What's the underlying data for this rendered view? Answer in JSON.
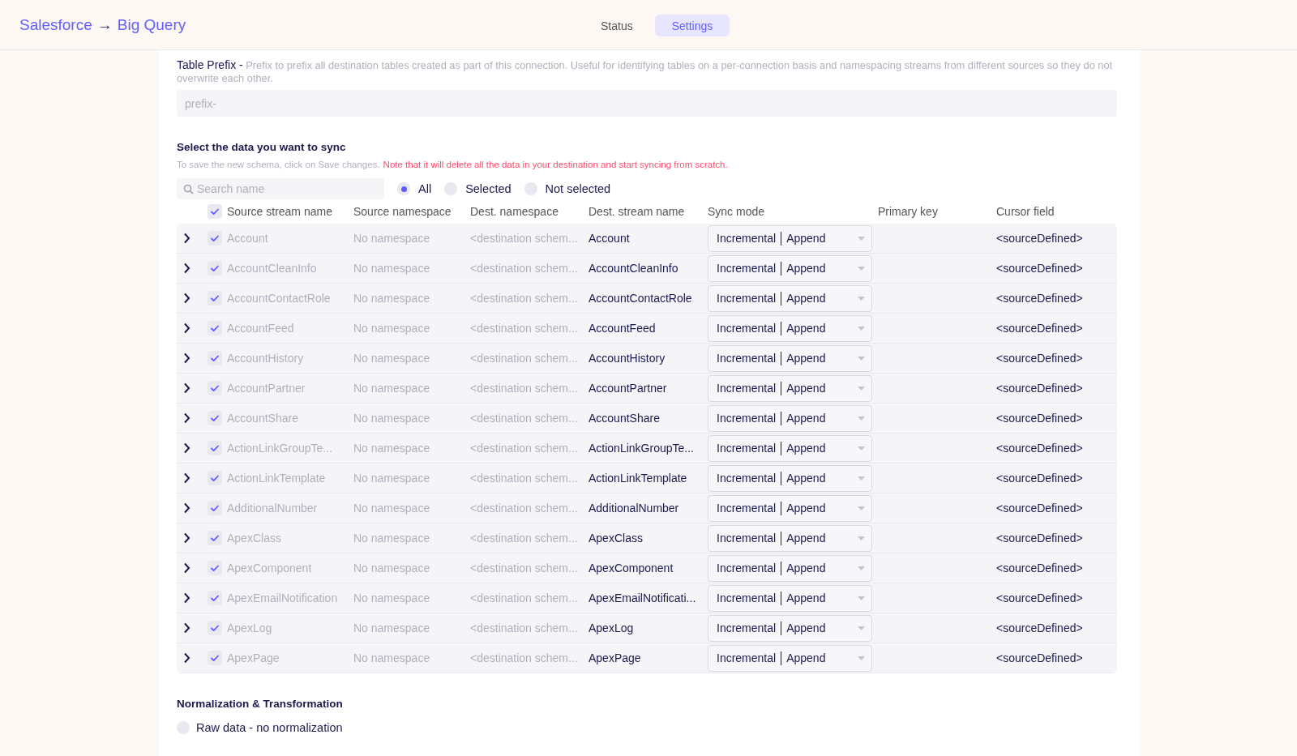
{
  "header": {
    "source": "Salesforce",
    "arrow": "→",
    "destination": "Big Query"
  },
  "tabs": [
    {
      "label": "Status",
      "selected": false
    },
    {
      "label": "Settings",
      "selected": true
    }
  ],
  "table_prefix": {
    "text": "**Table Prefix -** Prefix to prefix all destination tables created as part of this connection. Useful for identifying tables on a per-connection basis and namespacing streams from different sources so they do not overwrite each other.",
    "placeholder": "prefix-"
  },
  "sync_section": {
    "title": "Select the data you want to sync",
    "hint": "To save the new schema, click on Save changes.",
    "warning": "Note that it will delete all the data in your destination and start syncing from scratch."
  },
  "search": {
    "placeholder": "Search name"
  },
  "filters": [
    {
      "label": "All",
      "selected": true
    },
    {
      "label": "Selected",
      "selected": false
    },
    {
      "label": "Not selected",
      "selected": false
    }
  ],
  "table": {
    "all_checked": true,
    "columns": [
      "Source stream name",
      "Source namespace",
      "Dest. namespace",
      "Dest. stream name",
      "Sync mode",
      "Primary key",
      "Cursor field"
    ],
    "rows": [
      {
        "expanded": false,
        "checked": true,
        "source_name": "Account",
        "source_namespace": "No namespace",
        "dest_namespace": "<destination schem...",
        "dest_name": "Account",
        "sync_mode": "Incremental",
        "sync_dest_mode": "Append",
        "cursor_field": "<sourceDefined>"
      },
      {
        "expanded": false,
        "checked": true,
        "source_name": "AccountCleanInfo",
        "source_namespace": "No namespace",
        "dest_namespace": "<destination schem...",
        "dest_name": "AccountCleanInfo",
        "sync_mode": "Incremental",
        "sync_dest_mode": "Append",
        "cursor_field": "<sourceDefined>"
      },
      {
        "expanded": false,
        "checked": true,
        "source_name": "AccountContactRole",
        "source_namespace": "No namespace",
        "dest_namespace": "<destination schem...",
        "dest_name": "AccountContactRole",
        "sync_mode": "Incremental",
        "sync_dest_mode": "Append",
        "cursor_field": "<sourceDefined>"
      },
      {
        "expanded": false,
        "checked": true,
        "source_name": "AccountFeed",
        "source_namespace": "No namespace",
        "dest_namespace": "<destination schem...",
        "dest_name": "AccountFeed",
        "sync_mode": "Incremental",
        "sync_dest_mode": "Append",
        "cursor_field": "<sourceDefined>"
      },
      {
        "expanded": false,
        "checked": true,
        "source_name": "AccountHistory",
        "source_namespace": "No namespace",
        "dest_namespace": "<destination schem...",
        "dest_name": "AccountHistory",
        "sync_mode": "Incremental",
        "sync_dest_mode": "Append",
        "cursor_field": "<sourceDefined>"
      },
      {
        "expanded": false,
        "checked": true,
        "source_name": "AccountPartner",
        "source_namespace": "No namespace",
        "dest_namespace": "<destination schem...",
        "dest_name": "AccountPartner",
        "sync_mode": "Incremental",
        "sync_dest_mode": "Append",
        "cursor_field": "<sourceDefined>"
      },
      {
        "expanded": false,
        "checked": true,
        "source_name": "AccountShare",
        "source_namespace": "No namespace",
        "dest_namespace": "<destination schem...",
        "dest_name": "AccountShare",
        "sync_mode": "Incremental",
        "sync_dest_mode": "Append",
        "cursor_field": "<sourceDefined>"
      },
      {
        "expanded": false,
        "checked": true,
        "source_name": "ActionLinkGroupTe...",
        "source_namespace": "No namespace",
        "dest_namespace": "<destination schem...",
        "dest_name": "ActionLinkGroupTe...",
        "sync_mode": "Incremental",
        "sync_dest_mode": "Append",
        "cursor_field": "<sourceDefined>"
      },
      {
        "expanded": false,
        "checked": true,
        "source_name": "ActionLinkTemplate",
        "source_namespace": "No namespace",
        "dest_namespace": "<destination schem...",
        "dest_name": "ActionLinkTemplate",
        "sync_mode": "Incremental",
        "sync_dest_mode": "Append",
        "cursor_field": "<sourceDefined>"
      },
      {
        "expanded": false,
        "checked": true,
        "source_name": "AdditionalNumber",
        "source_namespace": "No namespace",
        "dest_namespace": "<destination schem...",
        "dest_name": "AdditionalNumber",
        "sync_mode": "Incremental",
        "sync_dest_mode": "Append",
        "cursor_field": "<sourceDefined>"
      },
      {
        "expanded": false,
        "checked": true,
        "source_name": "ApexClass",
        "source_namespace": "No namespace",
        "dest_namespace": "<destination schem...",
        "dest_name": "ApexClass",
        "sync_mode": "Incremental",
        "sync_dest_mode": "Append",
        "cursor_field": "<sourceDefined>"
      },
      {
        "expanded": false,
        "checked": true,
        "source_name": "ApexComponent",
        "source_namespace": "No namespace",
        "dest_namespace": "<destination schem...",
        "dest_name": "ApexComponent",
        "sync_mode": "Incremental",
        "sync_dest_mode": "Append",
        "cursor_field": "<sourceDefined>"
      },
      {
        "expanded": false,
        "checked": true,
        "source_name": "ApexEmailNotification",
        "source_namespace": "No namespace",
        "dest_namespace": "<destination schem...",
        "dest_name": "ApexEmailNotificati...",
        "sync_mode": "Incremental",
        "sync_dest_mode": "Append",
        "cursor_field": "<sourceDefined>"
      },
      {
        "expanded": false,
        "checked": true,
        "source_name": "ApexLog",
        "source_namespace": "No namespace",
        "dest_namespace": "<destination schem...",
        "dest_name": "ApexLog",
        "sync_mode": "Incremental",
        "sync_dest_mode": "Append",
        "cursor_field": "<sourceDefined>"
      },
      {
        "expanded": false,
        "checked": true,
        "source_name": "ApexPage",
        "source_namespace": "No namespace",
        "dest_namespace": "<destination schem...",
        "dest_name": "ApexPage",
        "sync_mode": "Incremental",
        "sync_dest_mode": "Append",
        "cursor_field": "<sourceDefined>"
      }
    ]
  },
  "normalization": {
    "title": "Normalization & Transformation",
    "options": [
      {
        "label": "Raw data - no normalization",
        "selected": false
      }
    ]
  }
}
